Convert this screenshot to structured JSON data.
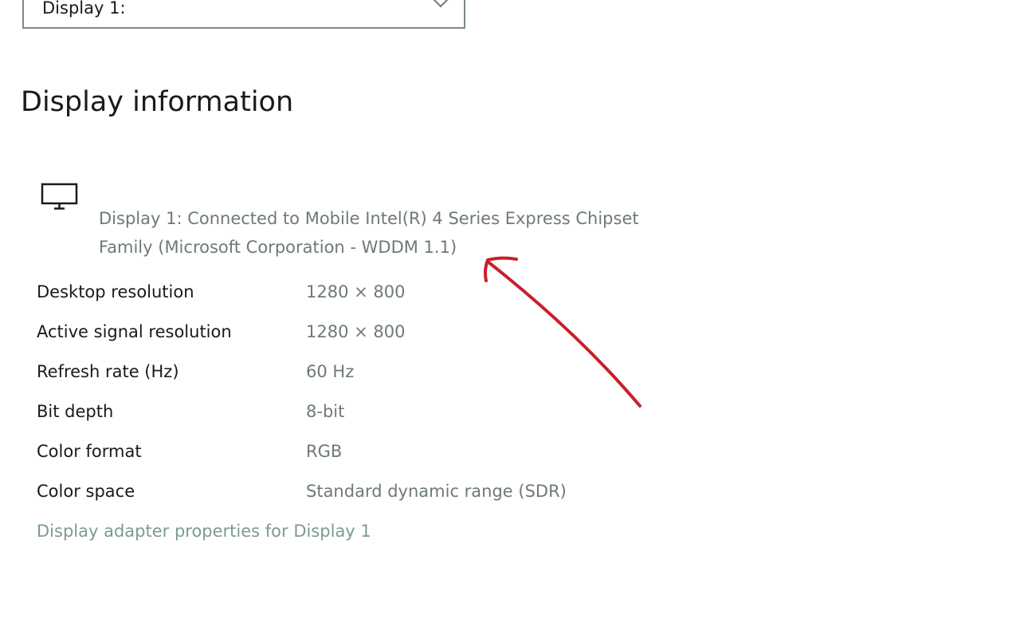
{
  "dropdown": {
    "selected": "Display 1:"
  },
  "section": {
    "title": "Display information"
  },
  "adapter": {
    "icon": "monitor-icon",
    "description_line1": "Display 1: Connected to Mobile Intel(R) 4 Series Express Chipset",
    "description_line2": "Family (Microsoft Corporation - WDDM 1.1)"
  },
  "info_rows": [
    {
      "label": "Desktop resolution",
      "value": "1280 × 800"
    },
    {
      "label": "Active signal resolution",
      "value": "1280 × 800"
    },
    {
      "label": "Refresh rate (Hz)",
      "value": "60 Hz"
    },
    {
      "label": "Bit depth",
      "value": "8-bit"
    },
    {
      "label": "Color format",
      "value": "RGB"
    },
    {
      "label": "Color space",
      "value": "Standard dynamic range (SDR)"
    }
  ],
  "link": {
    "label": "Display adapter properties for Display 1"
  },
  "colors": {
    "accent_link": "#7d9a92",
    "secondary_text": "#6e7a77",
    "annotation": "#c8202a"
  }
}
